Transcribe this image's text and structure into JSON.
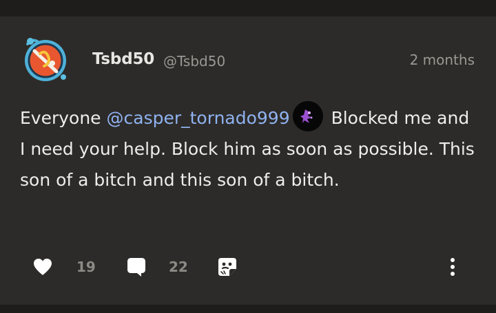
{
  "post": {
    "author": {
      "display_name": "Tsbd50",
      "handle": "@Tsbd50",
      "avatar_icon": "avatar-badge-icon"
    },
    "timestamp": "2 months",
    "body": {
      "text_before_mention": "Everyone ",
      "mention": "@casper_tornado999",
      "mention_avatar_icon": "avatar-icon",
      "text_after_mention": " Blocked me and I need your help. Block him as soon as possible. This son of a bitch and this son of a bitch."
    },
    "actions": {
      "like_icon": "heart-icon",
      "like_count": "19",
      "comment_icon": "comment-icon",
      "comment_count": "22",
      "share_icon": "share-icon",
      "more_icon": "more-vertical-icon"
    }
  },
  "colors": {
    "background": "#1f1d1b",
    "card": "#2d2b29",
    "text": "#efedea",
    "muted": "#9b9894",
    "mention": "#8fb2f0"
  }
}
